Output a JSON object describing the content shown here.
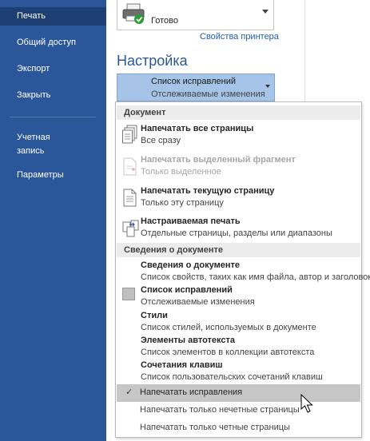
{
  "sidebar": {
    "items": [
      {
        "label": "Печать"
      },
      {
        "label": "Общий доступ"
      },
      {
        "label": "Экспорт"
      },
      {
        "label": "Закрыть"
      },
      {
        "label": "Учетная"
      },
      {
        "label": "запись"
      },
      {
        "label": "Параметры"
      }
    ]
  },
  "printer": {
    "status": "Готово",
    "properties_link": "Свойства принтера"
  },
  "settings": {
    "heading": "Настройка",
    "selector_title": "Список исправлений",
    "selector_subtitle": "Отслеживаемые изменения"
  },
  "dropdown": {
    "group_document": "Документ",
    "opt_all_title": "Напечатать все страницы",
    "opt_all_sub": "Все сразу",
    "opt_selection_title": "Напечатать выделенный фрагмент",
    "opt_selection_sub": "Только выделенное",
    "opt_current_title": "Напечатать текущую страницу",
    "opt_current_sub": "Только эту страницу",
    "opt_custom_title": "Настраиваемая печать",
    "opt_custom_sub": "Отдельные страницы, разделы или диапазоны",
    "group_info": "Сведения о документе",
    "opt_docinfo_title": "Сведения о документе",
    "opt_docinfo_sub": "Список свойств, таких как имя файла, автор и заголовок",
    "opt_markup_title": "Список исправлений",
    "opt_markup_sub": "Отслеживаемые изменения",
    "opt_styles_title": "Стили",
    "opt_styles_sub": "Список стилей, используемых в документе",
    "opt_autotext_title": "Элементы автотекста",
    "opt_autotext_sub": "Список элементов в коллекции автотекста",
    "opt_keys_title": "Сочетания клавиш",
    "opt_keys_sub": "Список пользовательских сочетаний клавиш",
    "opt_print_markup": "Напечатать исправления",
    "opt_odd": "Напечатать только нечетные страницы",
    "opt_even": "Напечатать только четные страницы"
  },
  "colors": {
    "sidebar_bg": "#2b579a",
    "sidebar_active": "#1e3f73",
    "accent": "#2b579a",
    "selector_bg": "#a5c4e8"
  }
}
